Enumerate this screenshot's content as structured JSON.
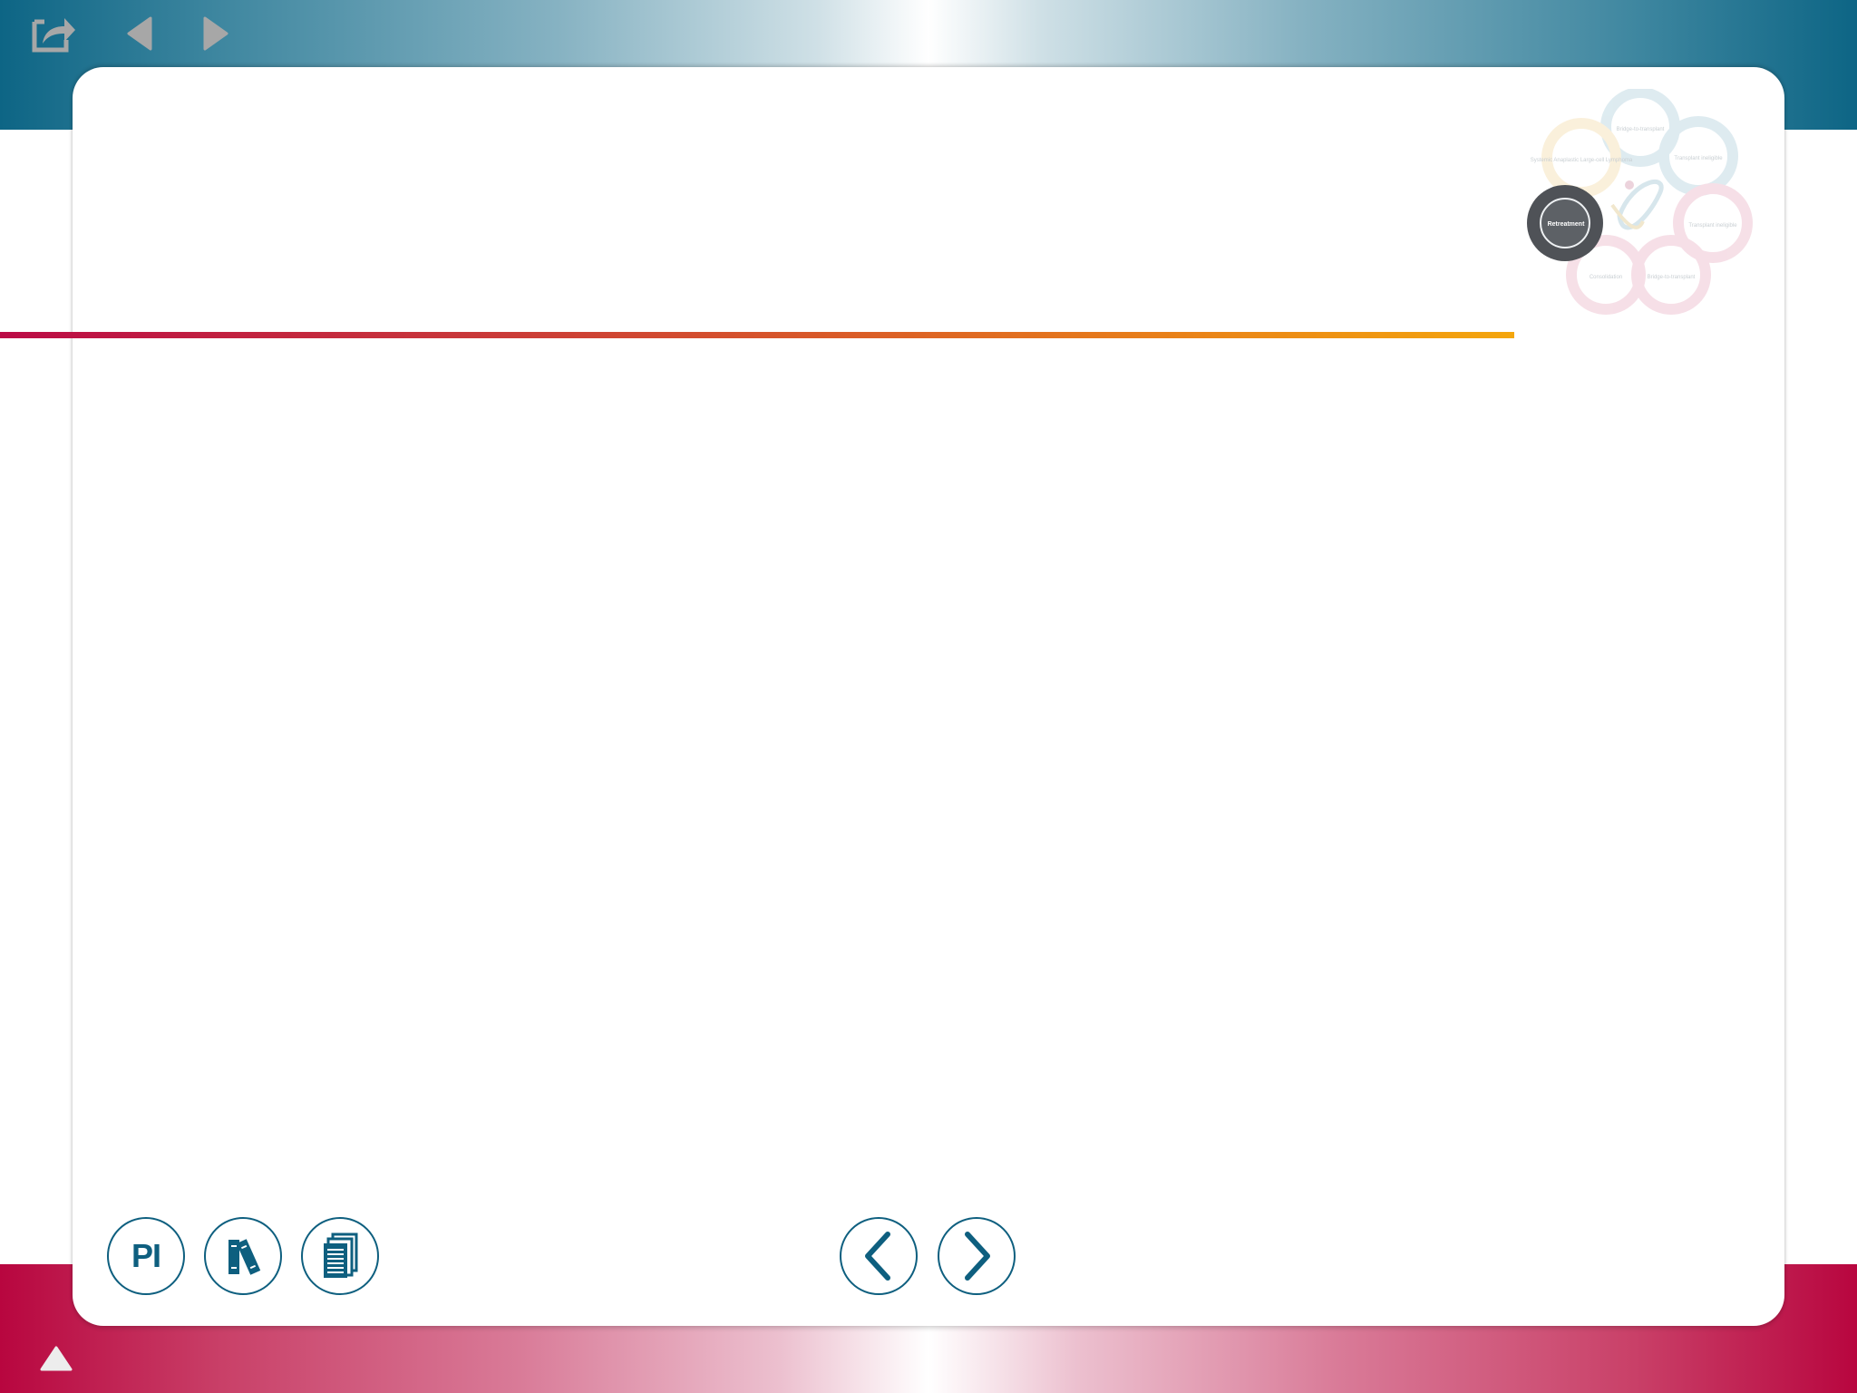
{
  "toolbar": {
    "share_icon": "share-icon",
    "back_icon": "triangle-left-icon",
    "forward_icon": "triangle-right-icon",
    "icon_color": "#a7a7a7"
  },
  "header": {
    "accent_gradient": [
      "#bb0b46",
      "#f4a60c"
    ]
  },
  "cycle_nav": {
    "active_label": "Retreatment",
    "active_color": "#4f5257",
    "items": [
      {
        "label": "Bridge-to-transplant",
        "color": "#d3e5ec"
      },
      {
        "label": "Transplant ineligible",
        "color": "#d3e5ec"
      },
      {
        "label": "Transplant ineligible",
        "color": "#f3d5df"
      },
      {
        "label": "Bridge-to-transplant",
        "color": "#f3d5df"
      },
      {
        "label": "Consolidation",
        "color": "#f3d5df"
      },
      {
        "label": "Retreatment",
        "color": "#4f5257"
      },
      {
        "label": "Systemic Anaplastic Large-cell Lymphoma",
        "color": "#f9ecd0"
      }
    ]
  },
  "footer": {
    "pi_label": "PI",
    "refs_icon": "books-icon",
    "docs_icon": "documents-icon",
    "prev_icon": "chevron-left-icon",
    "next_icon": "chevron-right-icon",
    "up_icon": "triangle-up-icon",
    "brand_color": "#0e5f7f"
  }
}
